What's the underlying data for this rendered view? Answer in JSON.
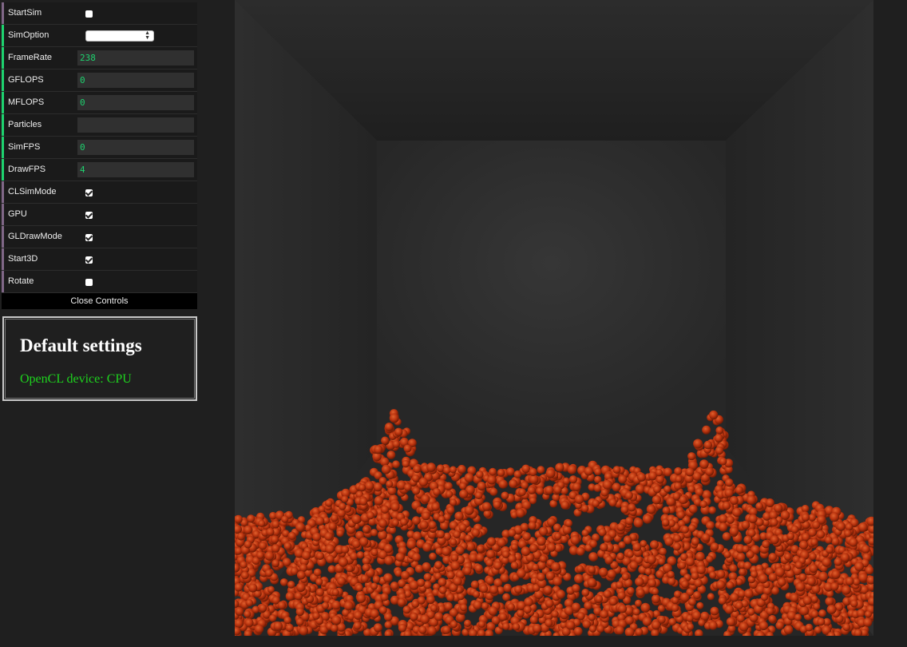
{
  "controls": {
    "start_sim": {
      "label": "StartSim",
      "checked": false
    },
    "sim_option": {
      "label": "SimOption",
      "value": ""
    },
    "frame_rate": {
      "label": "FrameRate",
      "value": "238"
    },
    "gflops": {
      "label": "GFLOPS",
      "value": "0"
    },
    "mflops": {
      "label": "MFLOPS",
      "value": "0"
    },
    "particles": {
      "label": "Particles",
      "value": ""
    },
    "sim_fps": {
      "label": "SimFPS",
      "value": "0"
    },
    "draw_fps": {
      "label": "DrawFPS",
      "value": "4"
    },
    "cl_sim_mode": {
      "label": "CLSimMode",
      "checked": true
    },
    "gpu": {
      "label": "GPU",
      "checked": true
    },
    "gl_draw_mode": {
      "label": "GLDrawMode",
      "checked": true
    },
    "start_3d": {
      "label": "Start3D",
      "checked": true
    },
    "rotate": {
      "label": "Rotate",
      "checked": false
    },
    "close_label": "Close Controls"
  },
  "info": {
    "title": "Default settings",
    "device": "OpenCL device: CPU"
  },
  "colors": {
    "accent_bool": "#806787",
    "accent_number": "#1ed36f",
    "particle": "#b8320e",
    "device_text": "#1ed31e"
  }
}
